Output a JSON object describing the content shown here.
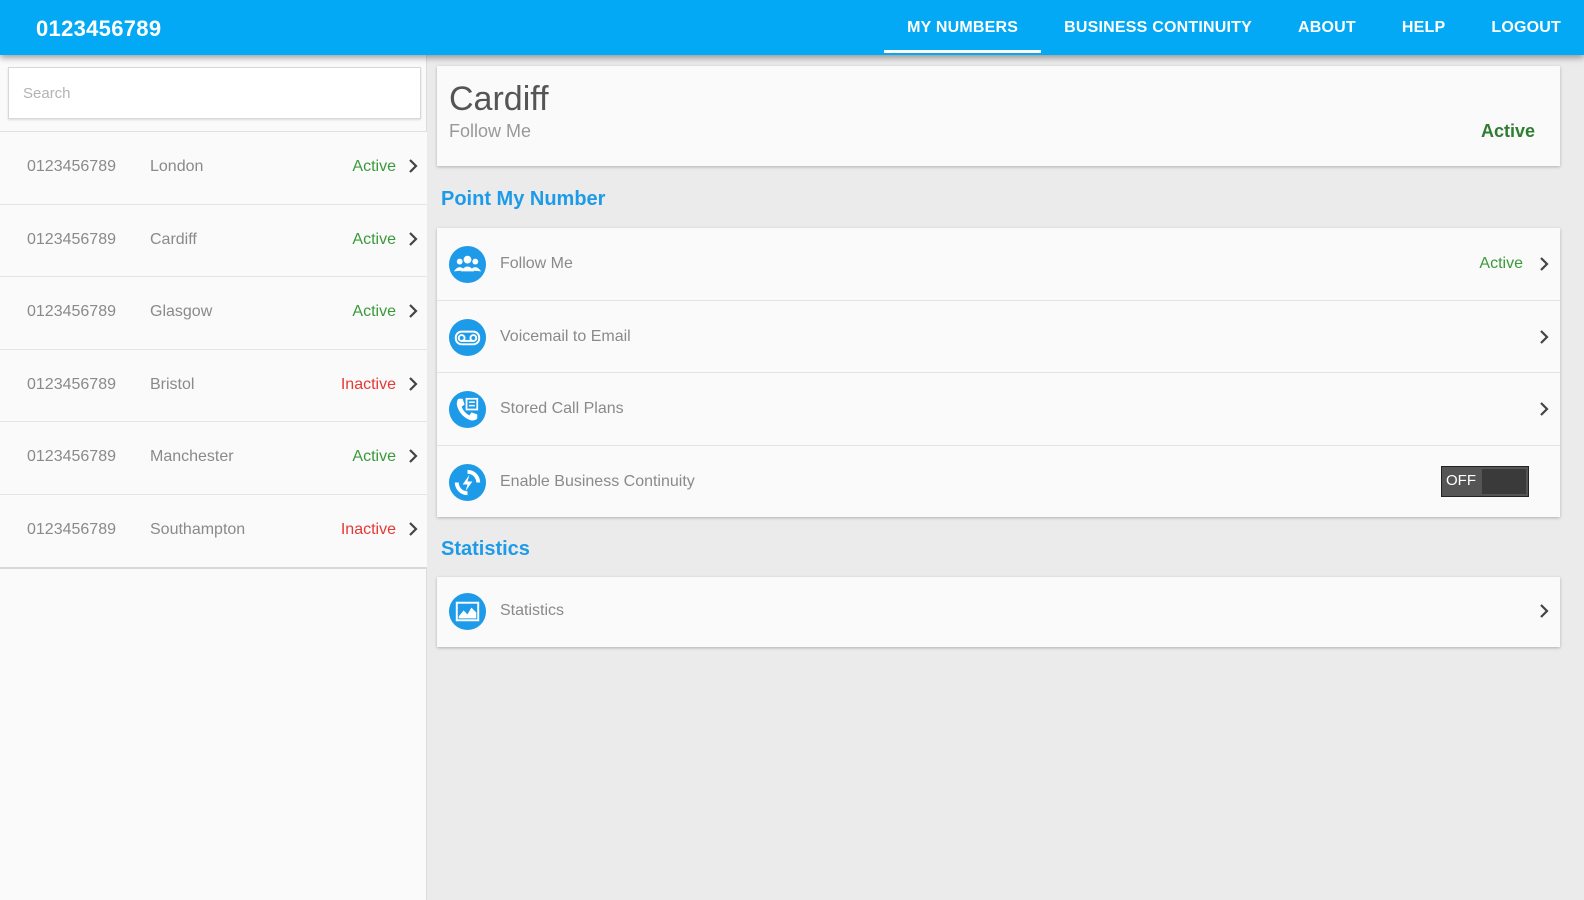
{
  "app": {
    "title": "0123456789"
  },
  "nav": [
    {
      "label": "MY NUMBERS",
      "active": true
    },
    {
      "label": "BUSINESS CONTINUITY",
      "active": false
    },
    {
      "label": "ABOUT",
      "active": false
    },
    {
      "label": "HELP",
      "active": false
    },
    {
      "label": "LOGOUT",
      "active": false
    }
  ],
  "search": {
    "placeholder": "Search",
    "value": ""
  },
  "numbers": [
    {
      "number": "0123456789",
      "city": "London",
      "status": "Active"
    },
    {
      "number": "0123456789",
      "city": "Cardiff",
      "status": "Active"
    },
    {
      "number": "0123456789",
      "city": "Glasgow",
      "status": "Active"
    },
    {
      "number": "0123456789",
      "city": "Bristol",
      "status": "Inactive"
    },
    {
      "number": "0123456789",
      "city": "Manchester",
      "status": "Active"
    },
    {
      "number": "0123456789",
      "city": "Southampton",
      "status": "Inactive"
    }
  ],
  "detail": {
    "title": "Cardiff",
    "subtitle": "Follow Me",
    "status": "Active"
  },
  "sections": {
    "point_my_number": {
      "title": "Point My Number",
      "items": [
        {
          "label": "Follow Me",
          "status": "Active",
          "icon": "people-icon"
        },
        {
          "label": "Voicemail to Email",
          "status": "",
          "icon": "voicemail-icon"
        },
        {
          "label": "Stored Call Plans",
          "status": "",
          "icon": "phone-book-icon"
        },
        {
          "label": "Enable Business Continuity",
          "status": "",
          "icon": "continuity-icon"
        }
      ],
      "toggle_label": "OFF"
    },
    "statistics": {
      "title": "Statistics",
      "items": [
        {
          "label": "Statistics",
          "icon": "chart-icon"
        }
      ]
    }
  },
  "colors": {
    "topbar": "#03a9f4",
    "accent": "#1e9be8",
    "active": "#3a9a3a",
    "inactive": "#e53935"
  }
}
